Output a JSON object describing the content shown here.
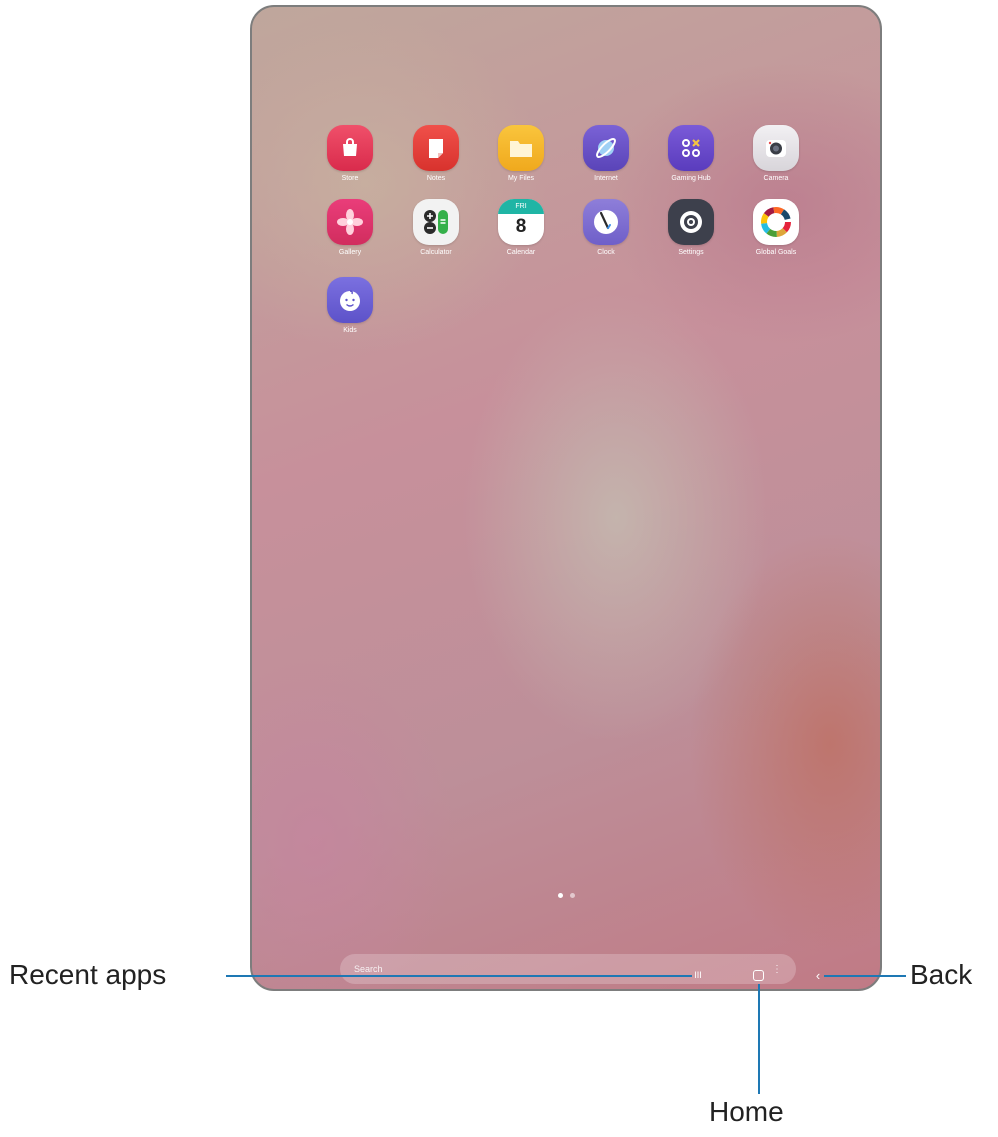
{
  "apps": [
    {
      "label": "Store",
      "icon": "store-icon",
      "color": "#e83f5a"
    },
    {
      "label": "Notes",
      "icon": "notes-icon",
      "color": "#e8403a"
    },
    {
      "label": "My Files",
      "icon": "my-files-icon",
      "color": "#f6b92b"
    },
    {
      "label": "Internet",
      "icon": "internet-icon",
      "color": "#6b55c6"
    },
    {
      "label": "Gaming Hub",
      "icon": "gaming-hub-icon",
      "color": "#6b4fcf"
    },
    {
      "label": "Camera",
      "icon": "camera-icon",
      "color": "#e9e7ea"
    },
    {
      "label": "Gallery",
      "icon": "gallery-icon",
      "color": "#e2336e"
    },
    {
      "label": "Calculator",
      "icon": "calculator-icon",
      "color": "#f2f2f2"
    },
    {
      "label": "Calendar",
      "icon": "calendar-icon",
      "color": "#ffffff"
    },
    {
      "label": "Clock",
      "icon": "clock-icon",
      "color": "#8b7bd6"
    },
    {
      "label": "Settings",
      "icon": "settings-icon",
      "color": "#4a4d5a"
    },
    {
      "label": "Global Goals",
      "icon": "global-goals-icon",
      "color": "#ffffff"
    },
    {
      "label": "Kids",
      "icon": "kids-icon",
      "color": "#6e64d8"
    }
  ],
  "calendar": {
    "day": "FRI",
    "date": "8"
  },
  "search": {
    "placeholder": "Search",
    "more": "⋮"
  },
  "navbar": {
    "recent_glyph": "III",
    "home_glyph": "○",
    "back_glyph": "‹"
  },
  "callouts": {
    "recent": "Recent apps",
    "home": "Home",
    "back": "Back"
  },
  "page_indicator": {
    "pages": 2,
    "current": 1
  }
}
